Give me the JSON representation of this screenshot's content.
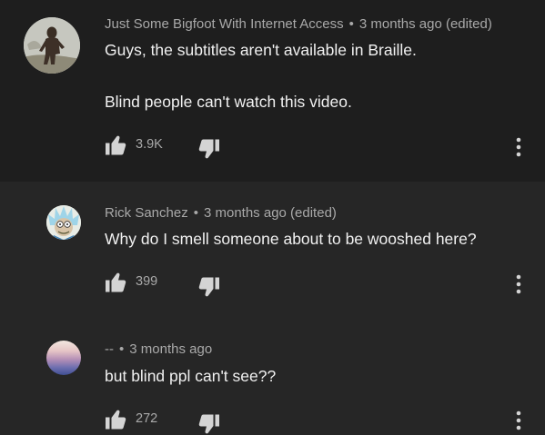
{
  "comments": [
    {
      "author": "Just Some Bigfoot With Internet Access",
      "separator": "•",
      "time": "3 months ago (edited)",
      "lines": [
        "Guys, the subtitles aren't available in Braille.",
        "Blind people can't watch this video."
      ],
      "likes": "3.9K",
      "avatar_icon": "bigfoot-avatar-icon"
    },
    {
      "author": "Rick Sanchez",
      "separator": "•",
      "time": "3 months ago (edited)",
      "lines": [
        "Why do I smell someone about to be wooshed here?"
      ],
      "likes": "399",
      "avatar_icon": "rick-avatar-icon"
    },
    {
      "author": "--",
      "separator": "•",
      "time": "3 months ago",
      "lines": [
        "but blind ppl can't see??"
      ],
      "likes": "272",
      "avatar_icon": "gradient-avatar-icon"
    }
  ],
  "icons": {
    "like": "thumbs-up-icon",
    "dislike": "thumbs-down-icon",
    "more": "more-vertical-icon"
  },
  "colors": {
    "background": "#262626",
    "first_comment_background": "#1e1e1e",
    "text": "#f1f1f1",
    "secondary_text": "#a9a9a9"
  }
}
